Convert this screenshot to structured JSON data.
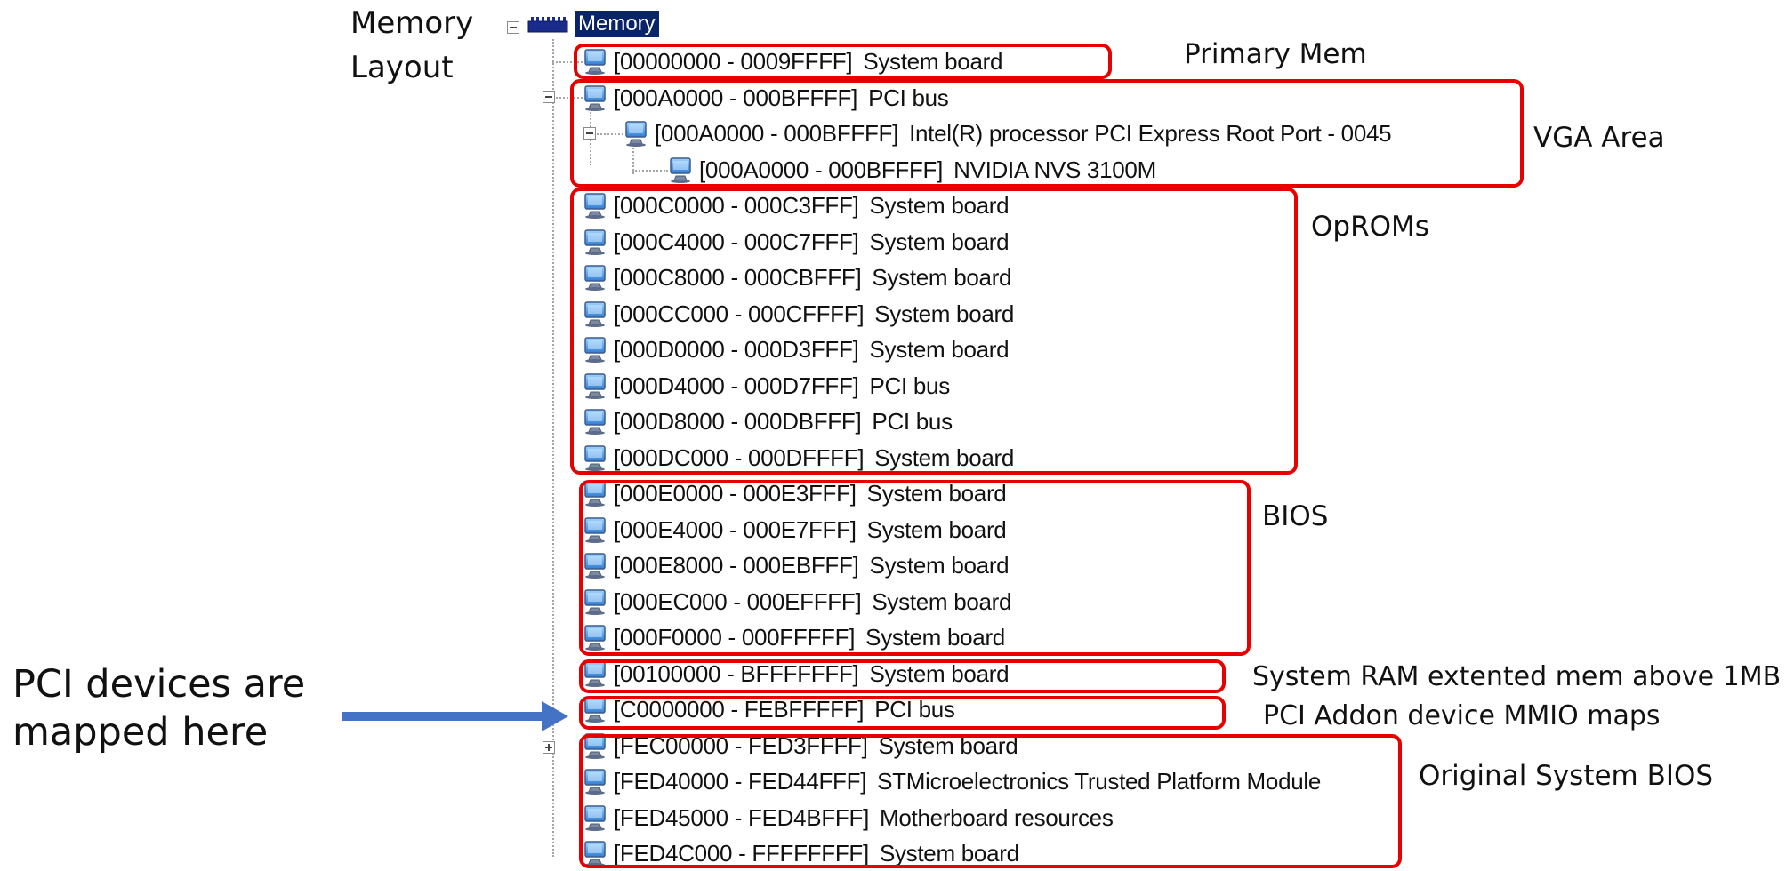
{
  "title": {
    "line1": "Memory",
    "line2": "Layout"
  },
  "tree": {
    "root_label": "Memory",
    "entries": [
      {
        "range": "[00000000 - 0009FFFF]",
        "name": "System board"
      },
      {
        "range": "[000A0000 - 000BFFFF]",
        "name": "PCI bus"
      },
      {
        "range": "[000A0000 - 000BFFFF]",
        "name": "Intel(R) processor PCI Express Root Port - 0045"
      },
      {
        "range": "[000A0000 - 000BFFFF]",
        "name": "NVIDIA NVS 3100M"
      },
      {
        "range": "[000C0000 - 000C3FFF]",
        "name": "System board"
      },
      {
        "range": "[000C4000 - 000C7FFF]",
        "name": "System board"
      },
      {
        "range": "[000C8000 - 000CBFFF]",
        "name": "System board"
      },
      {
        "range": "[000CC000 - 000CFFFF]",
        "name": "System board"
      },
      {
        "range": "[000D0000 - 000D3FFF]",
        "name": "System board"
      },
      {
        "range": "[000D4000 - 000D7FFF]",
        "name": "PCI bus"
      },
      {
        "range": "[000D8000 - 000DBFFF]",
        "name": "PCI bus"
      },
      {
        "range": "[000DC000 - 000DFFFF]",
        "name": "System board"
      },
      {
        "range": "[000E0000 - 000E3FFF]",
        "name": "System board"
      },
      {
        "range": "[000E4000 - 000E7FFF]",
        "name": "System board"
      },
      {
        "range": "[000E8000 - 000EBFFF]",
        "name": "System board"
      },
      {
        "range": "[000EC000 - 000EFFFF]",
        "name": "System board"
      },
      {
        "range": "[000F0000 - 000FFFFF]",
        "name": "System board"
      },
      {
        "range": "[00100000 - BFFFFFFF]",
        "name": "System board"
      },
      {
        "range": "[C0000000 - FEBFFFFF]",
        "name": "PCI bus"
      },
      {
        "range": "[FEC00000 - FED3FFFF]",
        "name": "System board"
      },
      {
        "range": "[FED40000 - FED44FFF]",
        "name": "STMicroelectronics Trusted Platform Module"
      },
      {
        "range": "[FED45000 - FED4BFFF]",
        "name": "Motherboard resources"
      },
      {
        "range": "[FED4C000 - FFFFFFFF]",
        "name": "System board"
      }
    ]
  },
  "annotations": {
    "primary_mem": "Primary Mem",
    "vga_area": "VGA Area",
    "oproms": "OpROMs",
    "bios": "BIOS",
    "system_ram": "System RAM extented mem above 1MB",
    "pci_addon": "PCI Addon device MMIO maps",
    "original_bios": "Original System BIOS",
    "pci_devices_line1": "PCI devices are",
    "pci_devices_line2": "mapped here"
  },
  "colors": {
    "highlight_border": "#e80000",
    "arrow": "#4472c4",
    "selection": "#0a246a"
  },
  "icons": {
    "device": "pc-device-icon",
    "root": "memory-chip-icon",
    "expander": "tree-expander-icon"
  }
}
